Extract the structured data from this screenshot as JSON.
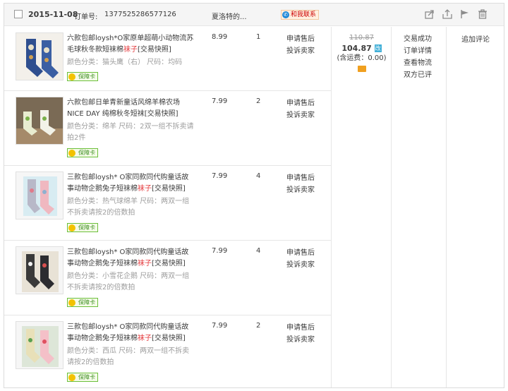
{
  "header": {
    "date": "2015-11-08",
    "order_label": "订单号:",
    "order_no": "1377525286577126",
    "shop": "夏洛特的...",
    "contact_label": "和我联系",
    "icons": [
      "share-icon",
      "upload-icon",
      "flag-icon",
      "trash-icon"
    ]
  },
  "items": [
    {
      "title_pre": "六款包邮loysh*O家原单超萌小动物流苏毛球秋冬款短袜棉",
      "title_hl": "袜子",
      "title_post": "[交易快照]",
      "attr": "颜色分类：猫头鹰（右） 尺码：均码",
      "badge": "保障卡",
      "price": "8.99",
      "qty": "1",
      "action1": "申请售后",
      "action2": "投诉卖家"
    },
    {
      "title_pre": "六款包邮日单青新童话风绵羊棉农场NICE DAY 纯棉秋冬短袜[交易快照]",
      "title_hl": "",
      "title_post": "",
      "attr": "颜色分类：绵羊 尺码：2双一组不拆卖请拍2件",
      "badge": "保障卡",
      "price": "7.99",
      "qty": "2",
      "action1": "申请售后",
      "action2": "投诉卖家"
    },
    {
      "title_pre": "三款包邮loysh* O家同款同代购童话故事动物企鹅兔子短袜棉",
      "title_hl": "袜子",
      "title_post": "[交易快照]",
      "attr": "颜色分类：热气球绵羊 尺码：两双一组不拆卖请按2的倍数拍",
      "badge": "保障卡",
      "price": "7.99",
      "qty": "4",
      "action1": "申请售后",
      "action2": "投诉卖家"
    },
    {
      "title_pre": "三款包邮loysh* O家同款同代购童话故事动物企鹅兔子短袜棉",
      "title_hl": "袜子",
      "title_post": "[交易快照]",
      "attr": "颜色分类：小雪花企鹅 尺码：两双一组不拆卖请按2的倍数拍",
      "badge": "保障卡",
      "price": "7.99",
      "qty": "4",
      "action1": "申请售后",
      "action2": "投诉卖家"
    },
    {
      "title_pre": "三款包邮loysh* O家同款同代购童话故事动物企鹅兔子短袜棉",
      "title_hl": "袜子",
      "title_post": "[交易快照]",
      "attr": "颜色分类：西瓜 尺码：两双一组不拆卖请按2的倍数拍",
      "badge": "保障卡",
      "price": "7.99",
      "qty": "2",
      "action1": "申请售后",
      "action2": "投诉卖家"
    }
  ],
  "total": {
    "original": "110.87",
    "paid": "104.87",
    "changed_tag": "改",
    "shipping": "(含运费：0.00)"
  },
  "status": {
    "state": "交易成功",
    "detail": "订单详情",
    "logistics": "查看物流",
    "rated": "双方已评"
  },
  "review": {
    "label": "追加评论"
  },
  "colors": {
    "highlight": "#e4393c",
    "badge_green": "#3b8d1f",
    "changed_blue": "#42b0d8"
  }
}
